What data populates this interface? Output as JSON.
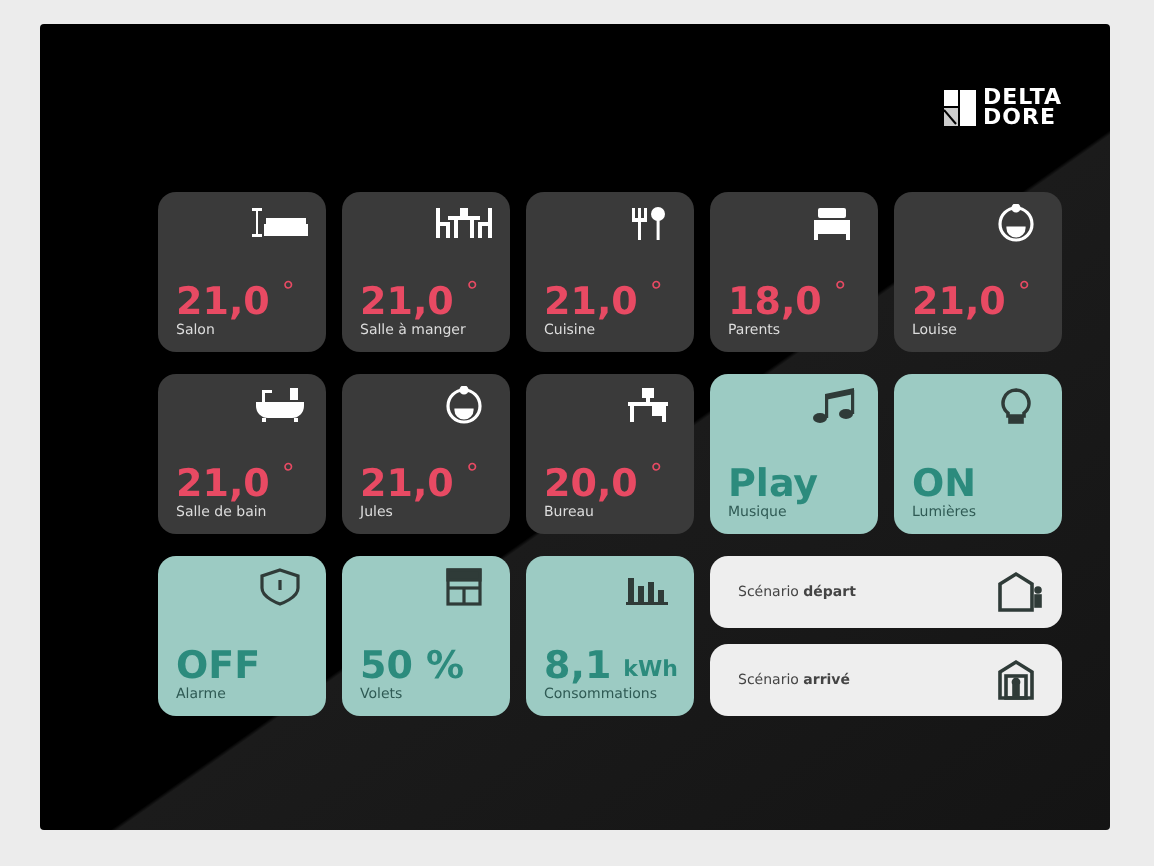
{
  "logo": {
    "line_1": "DELTA",
    "line_2": "DORE"
  },
  "tiles": [
    {
      "kind": "temperature",
      "value": "21,0",
      "unit": "°",
      "label": "Salon"
    },
    {
      "kind": "temperature",
      "value": "21,0",
      "unit": "°",
      "label": "Salle à manger"
    },
    {
      "kind": "temperature",
      "value": "21,0",
      "unit": "°",
      "label": "Cuisine"
    },
    {
      "kind": "temperature",
      "value": "18,0",
      "unit": "°",
      "label": "Parents"
    },
    {
      "kind": "temperature",
      "value": "21,0",
      "unit": "°",
      "label": "Louise"
    },
    {
      "kind": "temperature",
      "value": "21,0",
      "unit": "°",
      "label": "Salle de bain"
    },
    {
      "kind": "temperature",
      "value": "21,0",
      "unit": "°",
      "label": "Jules"
    },
    {
      "kind": "temperature",
      "value": "20,0",
      "unit": "°",
      "label": "Bureau"
    },
    {
      "kind": "status",
      "value": "Play",
      "label": "Musique"
    },
    {
      "kind": "status",
      "value": "ON",
      "label": "Lumières"
    },
    {
      "kind": "status",
      "value": "OFF",
      "label": "Alarme"
    },
    {
      "kind": "status",
      "value": "50 %",
      "label": "Volets"
    },
    {
      "kind": "status",
      "value": "8,1",
      "unit": "kWh",
      "label": "Consommations"
    }
  ],
  "scenarios": [
    {
      "label": "Scénario **départ**"
    },
    {
      "label": "Scénario **arrivé**"
    }
  ]
}
